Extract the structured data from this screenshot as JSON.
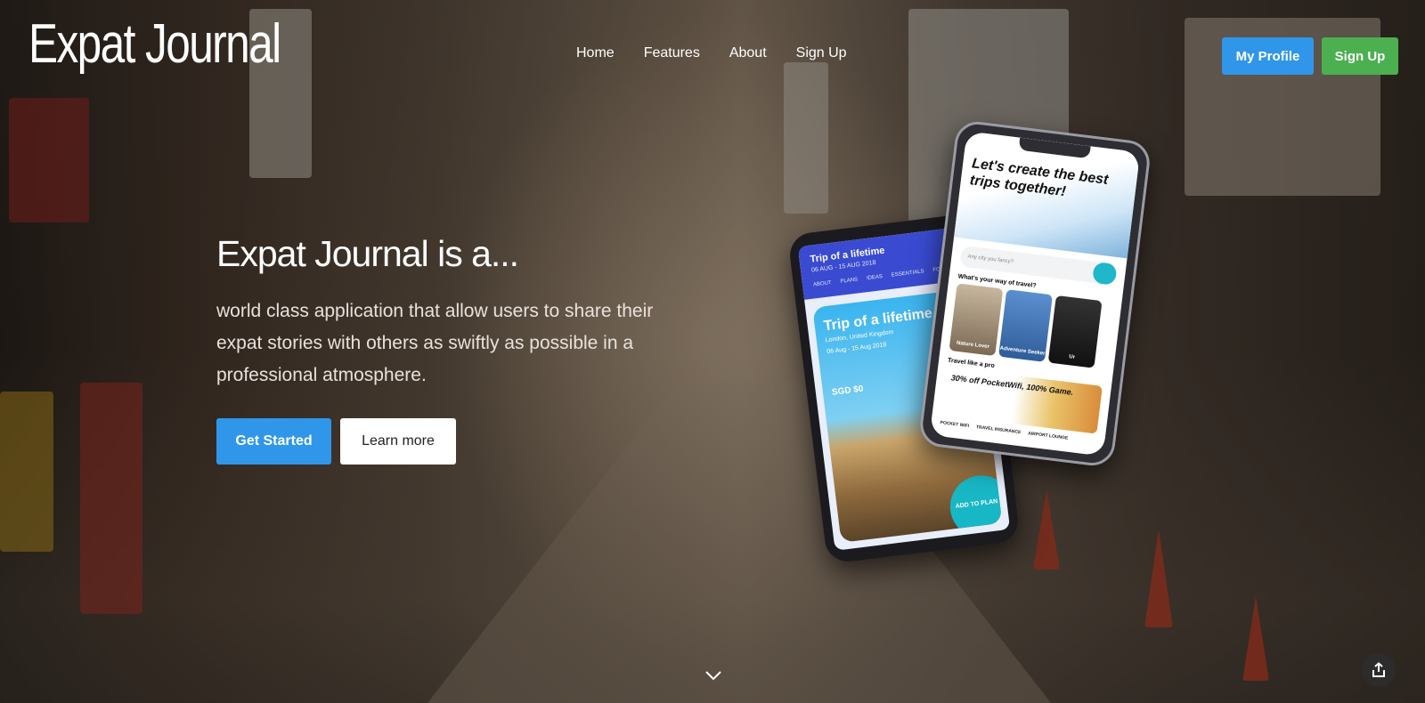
{
  "header": {
    "logo": "Expat Journal",
    "nav": [
      "Home",
      "Features",
      "About",
      "Sign Up"
    ],
    "profile_button": "My Profile",
    "signup_button": "Sign Up"
  },
  "hero": {
    "title": "Expat Journal is a...",
    "description": "world class application that allow users to share their expat stories with others as swiftly as possible in a professional atmosphere.",
    "primary_cta": "Get Started",
    "secondary_cta": "Learn more"
  },
  "phone_left": {
    "title": "Trip of a lifetime",
    "dates": "06 AUG - 15 AUG 2018",
    "tabs": [
      "ABOUT",
      "PLANS",
      "IDEAS",
      "ESSENTIALS",
      "FOLLOW"
    ],
    "card_title": "Trip of a lifetime",
    "card_sub": "London, United Kingdom",
    "card_dates": "06 Aug - 15 Aug 2018",
    "price": "SGD $0",
    "add_label": "ADD TO PLAN"
  },
  "phone_right": {
    "headline": "Let's create the best trips together!",
    "search_placeholder": "Any city you fancy?",
    "question": "What's your way of travel?",
    "tiles": [
      "Nature Lover",
      "Adventure Seeker",
      "Ur"
    ],
    "section": "Travel like a pro",
    "promo": "30% off PocketWifi, 100% Game.",
    "footer": [
      "POCKET WIFI",
      "TRAVEL INSURANCE",
      "AIRPORT LOUNGE"
    ]
  },
  "icons": {
    "scroll": "chevron-down-icon",
    "share": "share-icon"
  },
  "colors": {
    "primary": "#2f96ea",
    "success": "#4caf50"
  }
}
